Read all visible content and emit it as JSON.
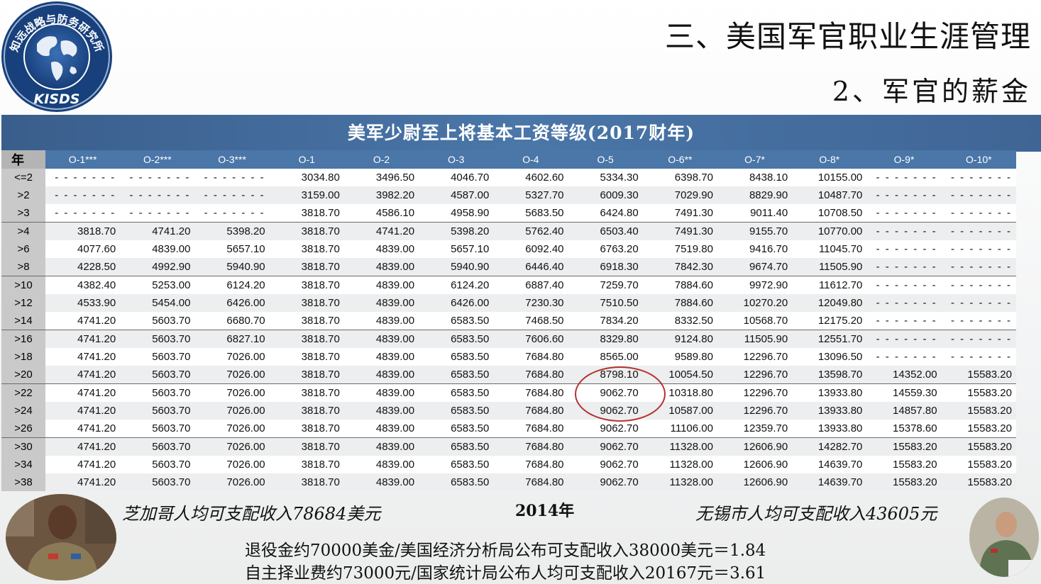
{
  "header": {
    "logo_text": "知远战略与防务研究所",
    "logo_abbr": "KISDS",
    "title": "三、美国军官职业生涯管理",
    "subtitle": "2、军官的薪金"
  },
  "table": {
    "banner": "美军少尉至上将基本工资等级(2017财年)",
    "year_header": "年",
    "columns": [
      "O-1***",
      "O-2***",
      "O-3***",
      "O-1",
      "O-2",
      "O-3",
      "O-4",
      "O-5",
      "O-6**",
      "O-7*",
      "O-8*",
      "O-9*",
      "O-10*"
    ],
    "dash": "- - - - - - -",
    "rows": [
      {
        "year": "<=2",
        "values": [
          "-",
          "-",
          "-",
          "3034.80",
          "3496.50",
          "4046.70",
          "4602.60",
          "5334.30",
          "6398.70",
          "8438.10",
          "10155.00",
          "-",
          "-"
        ]
      },
      {
        "year": ">2",
        "values": [
          "-",
          "-",
          "-",
          "3159.00",
          "3982.20",
          "4587.00",
          "5327.70",
          "6009.30",
          "7029.90",
          "8829.90",
          "10487.70",
          "-",
          "-"
        ]
      },
      {
        "year": ">3",
        "values": [
          "-",
          "-",
          "-",
          "3818.70",
          "4586.10",
          "4958.90",
          "5683.50",
          "6424.80",
          "7491.30",
          "9011.40",
          "10708.50",
          "-",
          "-"
        ]
      },
      {
        "year": ">4",
        "values": [
          "3818.70",
          "4741.20",
          "5398.20",
          "3818.70",
          "4741.20",
          "5398.20",
          "5762.40",
          "6503.40",
          "7491.30",
          "9155.70",
          "10770.00",
          "-",
          "-"
        ]
      },
      {
        "year": ">6",
        "values": [
          "4077.60",
          "4839.00",
          "5657.10",
          "3818.70",
          "4839.00",
          "5657.10",
          "6092.40",
          "6763.20",
          "7519.80",
          "9416.70",
          "11045.70",
          "-",
          "-"
        ]
      },
      {
        "year": ">8",
        "values": [
          "4228.50",
          "4992.90",
          "5940.90",
          "3818.70",
          "4839.00",
          "5940.90",
          "6446.40",
          "6918.30",
          "7842.30",
          "9674.70",
          "11505.90",
          "-",
          "-"
        ]
      },
      {
        "year": ">10",
        "values": [
          "4382.40",
          "5253.00",
          "6124.20",
          "3818.70",
          "4839.00",
          "6124.20",
          "6887.40",
          "7259.70",
          "7884.60",
          "9972.90",
          "11612.70",
          "-",
          "-"
        ]
      },
      {
        "year": ">12",
        "values": [
          "4533.90",
          "5454.00",
          "6426.00",
          "3818.70",
          "4839.00",
          "6426.00",
          "7230.30",
          "7510.50",
          "7884.60",
          "10270.20",
          "12049.80",
          "-",
          "-"
        ]
      },
      {
        "year": ">14",
        "values": [
          "4741.20",
          "5603.70",
          "6680.70",
          "3818.70",
          "4839.00",
          "6583.50",
          "7468.50",
          "7834.20",
          "8332.50",
          "10568.70",
          "12175.20",
          "-",
          "-"
        ]
      },
      {
        "year": ">16",
        "values": [
          "4741.20",
          "5603.70",
          "6827.10",
          "3818.70",
          "4839.00",
          "6583.50",
          "7606.60",
          "8329.80",
          "9124.80",
          "11505.90",
          "12551.70",
          "-",
          "-"
        ]
      },
      {
        "year": ">18",
        "values": [
          "4741.20",
          "5603.70",
          "7026.00",
          "3818.70",
          "4839.00",
          "6583.50",
          "7684.80",
          "8565.00",
          "9589.80",
          "12296.70",
          "13096.50",
          "-",
          "-"
        ]
      },
      {
        "year": ">20",
        "values": [
          "4741.20",
          "5603.70",
          "7026.00",
          "3818.70",
          "4839.00",
          "6583.50",
          "7684.80",
          "8798.10",
          "10054.50",
          "12296.70",
          "13598.70",
          "14352.00",
          "15583.20"
        ]
      },
      {
        "year": ">22",
        "values": [
          "4741.20",
          "5603.70",
          "7026.00",
          "3818.70",
          "4839.00",
          "6583.50",
          "7684.80",
          "9062.70",
          "10318.80",
          "12296.70",
          "13933.80",
          "14559.30",
          "15583.20"
        ]
      },
      {
        "year": ">24",
        "values": [
          "4741.20",
          "5603.70",
          "7026.00",
          "3818.70",
          "4839.00",
          "6583.50",
          "7684.80",
          "9062.70",
          "10587.00",
          "12296.70",
          "13933.80",
          "14857.80",
          "15583.20"
        ]
      },
      {
        "year": ">26",
        "values": [
          "4741.20",
          "5603.70",
          "7026.00",
          "3818.70",
          "4839.00",
          "6583.50",
          "7684.80",
          "9062.70",
          "11106.00",
          "12359.70",
          "13933.80",
          "15378.60",
          "15583.20"
        ]
      },
      {
        "year": ">30",
        "values": [
          "4741.20",
          "5603.70",
          "7026.00",
          "3818.70",
          "4839.00",
          "6583.50",
          "7684.80",
          "9062.70",
          "11328.00",
          "12606.90",
          "14282.70",
          "15583.20",
          "15583.20"
        ]
      },
      {
        "year": ">34",
        "values": [
          "4741.20",
          "5603.70",
          "7026.00",
          "3818.70",
          "4839.00",
          "6583.50",
          "7684.80",
          "9062.70",
          "11328.00",
          "12606.90",
          "14639.70",
          "15583.20",
          "15583.20"
        ]
      },
      {
        "year": ">38",
        "values": [
          "4741.20",
          "5603.70",
          "7026.00",
          "3818.70",
          "4839.00",
          "6583.50",
          "7684.80",
          "9062.70",
          "11328.00",
          "12606.90",
          "14639.70",
          "15583.20",
          "15583.20"
        ]
      }
    ],
    "group_start_rows": [
      3,
      6,
      9,
      12,
      15
    ],
    "highlight_color": "#b8302c"
  },
  "footer": {
    "chicago": "芝加哥人均可支配收入78684美元",
    "year": "2014年",
    "wuxi": "无锡市人均可支配收入43605元",
    "line1": "退役金约70000美金/美国经济分析局公布可支配收入38000美元＝1.84",
    "line2": "自主择业费约73000元/国家统计局公布人均可支配收入20167元＝3.61"
  },
  "colors": {
    "banner_blue": "#4a76a8",
    "header_blue": "#4a76a8",
    "year_gray": "#c9c9c9",
    "circle_red": "#b8302c"
  }
}
